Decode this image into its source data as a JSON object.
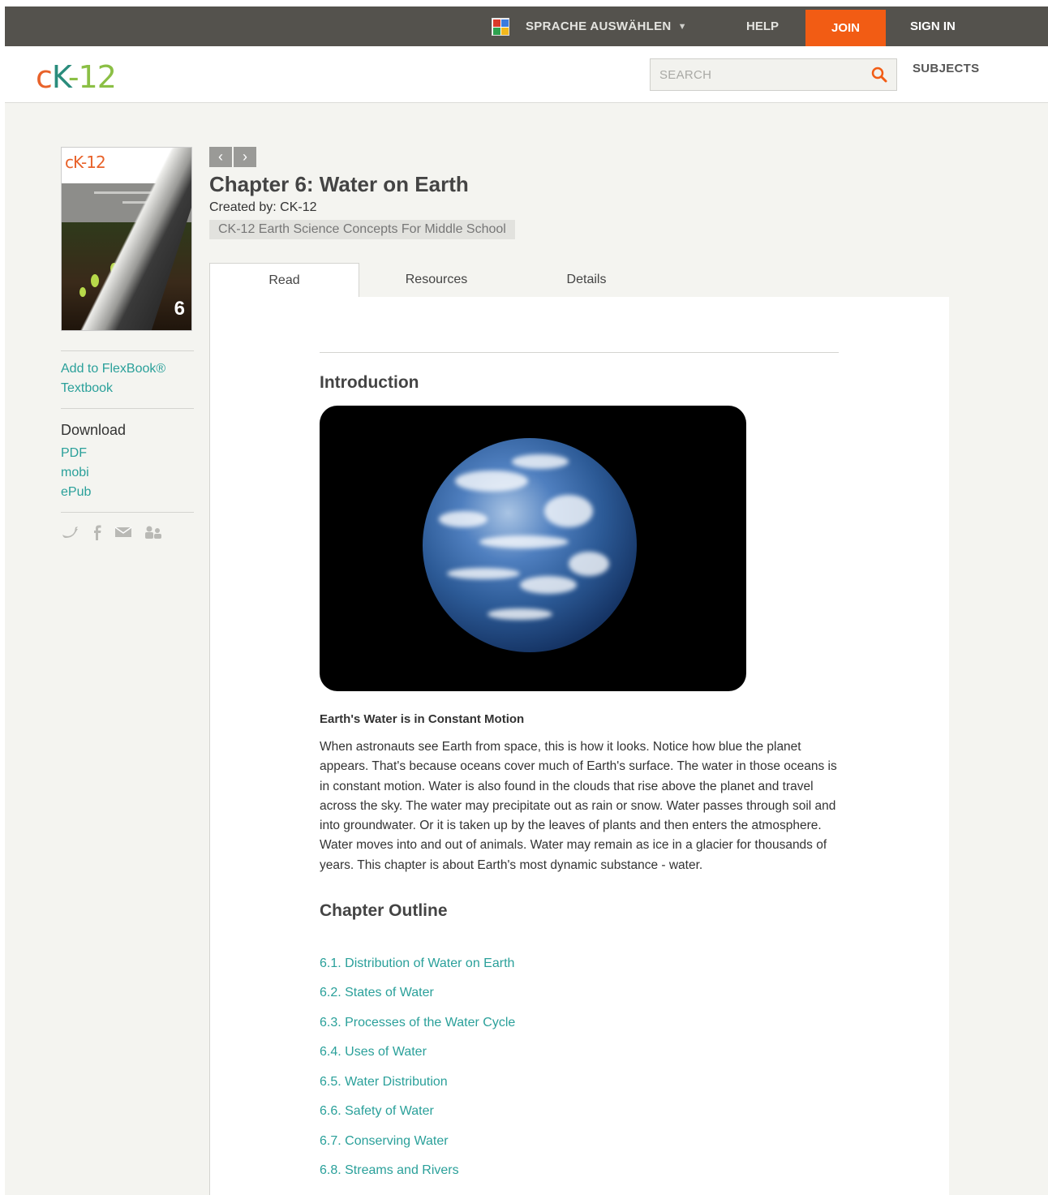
{
  "topbar": {
    "language_label": "SPRACHE AUSWÄHLEN",
    "help_label": "HELP",
    "join_label": "JOIN",
    "signin_label": "SIGN IN"
  },
  "header": {
    "logo_c": "c",
    "logo_k": "K",
    "logo_n": "-12",
    "search_placeholder": "SEARCH",
    "subjects_label": "SUBJECTS"
  },
  "sidebar": {
    "cover_logo": "cK-12",
    "cover_number": "6",
    "add_label_1": "Add to FlexBook®",
    "add_label_2": "Textbook",
    "download_heading": "Download",
    "downloads": [
      "PDF",
      "mobi",
      "ePub"
    ]
  },
  "chapter": {
    "title": "Chapter 6: Water on Earth",
    "created_by": "Created by: CK-12",
    "book_tag": "CK-12 Earth Science Concepts For Middle School"
  },
  "tabs": [
    "Read",
    "Resources",
    "Details"
  ],
  "content": {
    "intro_heading": "Introduction",
    "caption": "Earth's Water is in Constant Motion",
    "paragraph": "When astronauts see Earth from space, this is how it looks. Notice how blue the planet appears. That's because oceans cover much of Earth's surface. The water in those oceans is in constant motion. Water is also found in the clouds that rise above the planet and travel across the sky. The water may precipitate out as rain or snow. Water passes through soil and into groundwater. Or it is taken up by the leaves of plants and then enters the atmosphere. Water moves into and out of animals. Water may remain as ice in a glacier for thousands of years. This chapter is about Earth's most dynamic substance - water.",
    "outline_heading": "Chapter Outline",
    "outline": [
      "6.1. Distribution of Water on Earth",
      "6.2. States of Water",
      "6.3. Processes of the Water Cycle",
      "6.4. Uses of Water",
      "6.5. Water Distribution",
      "6.6. Safety of Water",
      "6.7. Conserving Water",
      "6.8. Streams and Rivers"
    ]
  },
  "colors": {
    "topbar": "#54524d",
    "join": "#f25c14",
    "link": "#2aa09a"
  }
}
